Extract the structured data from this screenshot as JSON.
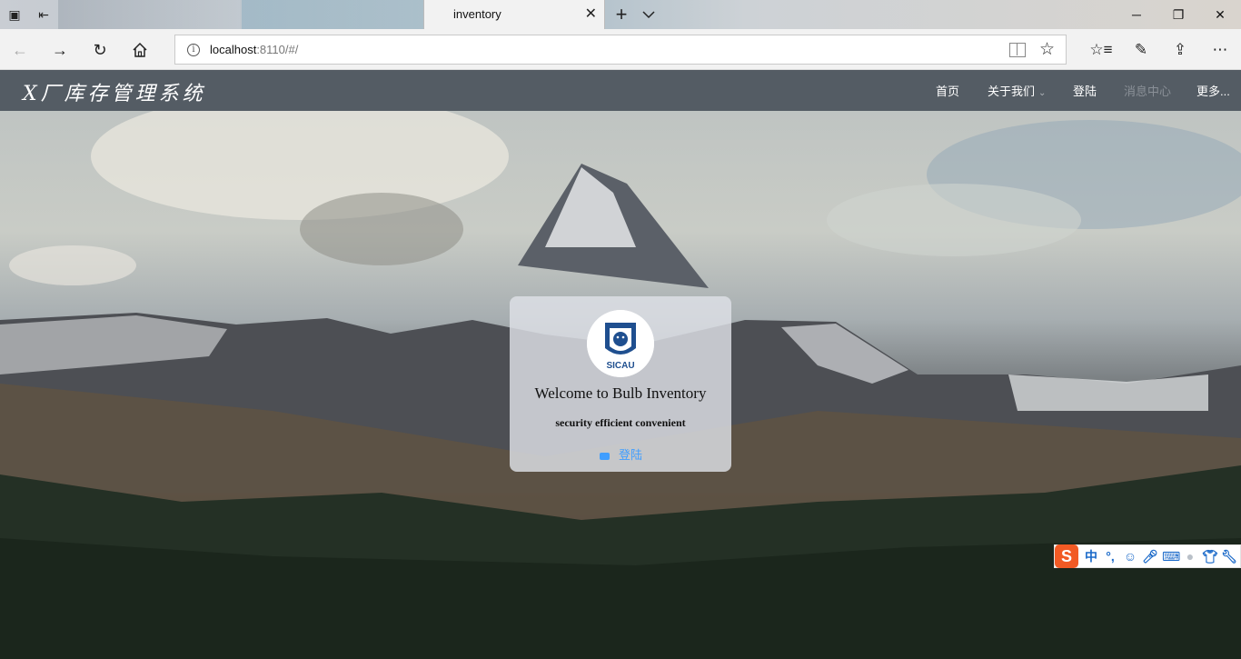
{
  "browser": {
    "tab_title": "inventory",
    "url_host": "localhost",
    "url_rest": ":8110/#/"
  },
  "site": {
    "brand": "X厂库存管理系统",
    "menu": [
      {
        "label": "首页"
      },
      {
        "label": "关于我们"
      },
      {
        "label": "登陆"
      },
      {
        "label": "消息中心"
      },
      {
        "label": "更多..."
      }
    ]
  },
  "card": {
    "logo_text": "SICAU",
    "title": "Welcome to Bulb Inventory",
    "subtitle": "security efficient convenient",
    "login_label": "登陆"
  },
  "ime": {
    "brand_letter": "S",
    "mode": "中",
    "punct": "°,"
  },
  "colors": {
    "header_bg": "#545c64",
    "link": "#409eff",
    "ime_brand": "#f25a24",
    "muted_menu": "#8a9097"
  }
}
